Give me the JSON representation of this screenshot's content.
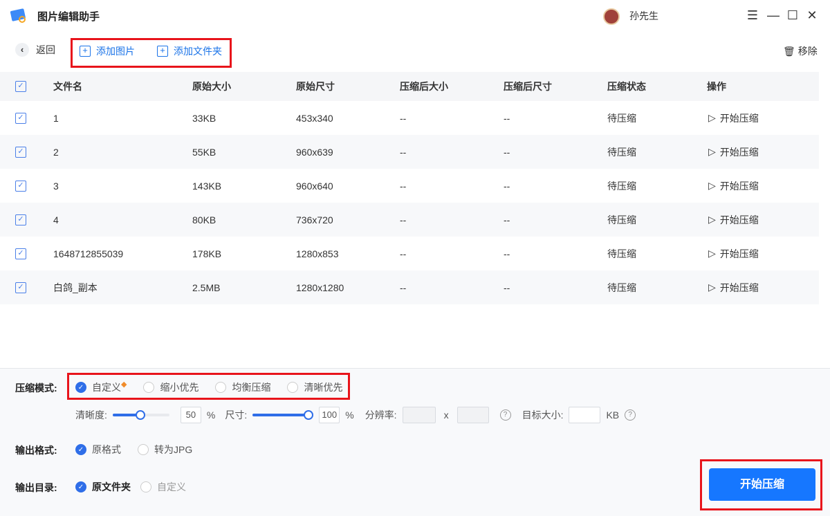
{
  "app": {
    "title": "图片编辑助手",
    "user": "孙先生"
  },
  "toolbar": {
    "back": "返回",
    "add_image": "添加图片",
    "add_folder": "添加文件夹",
    "remove": "移除"
  },
  "table": {
    "headers": [
      "文件名",
      "原始大小",
      "原始尺寸",
      "压缩后大小",
      "压缩后尺寸",
      "压缩状态",
      "操作"
    ],
    "rows": [
      {
        "name": "1",
        "size": "33KB",
        "dims": "453x340",
        "csize": "--",
        "cdims": "--",
        "status": "待压缩",
        "action": "开始压缩"
      },
      {
        "name": "2",
        "size": "55KB",
        "dims": "960x639",
        "csize": "--",
        "cdims": "--",
        "status": "待压缩",
        "action": "开始压缩"
      },
      {
        "name": "3",
        "size": "143KB",
        "dims": "960x640",
        "csize": "--",
        "cdims": "--",
        "status": "待压缩",
        "action": "开始压缩"
      },
      {
        "name": "4",
        "size": "80KB",
        "dims": "736x720",
        "csize": "--",
        "cdims": "--",
        "status": "待压缩",
        "action": "开始压缩"
      },
      {
        "name": "1648712855039",
        "size": "178KB",
        "dims": "1280x853",
        "csize": "--",
        "cdims": "--",
        "status": "待压缩",
        "action": "开始压缩"
      },
      {
        "name": "白鸽_副本",
        "size": "2.5MB",
        "dims": "1280x1280",
        "csize": "--",
        "cdims": "--",
        "status": "待压缩",
        "action": "开始压缩"
      }
    ]
  },
  "settings": {
    "mode_label": "压缩模式:",
    "modes": [
      "自定义",
      "缩小优先",
      "均衡压缩",
      "清晰优先"
    ],
    "clarity_label": "清晰度:",
    "clarity_value": "50",
    "size_label": "尺寸:",
    "size_value": "100",
    "percent": "%",
    "resolution_label": "分辨率:",
    "x": "x",
    "target_label": "目标大小:",
    "kb": "KB",
    "format_label": "输出格式:",
    "formats": [
      "原格式",
      "转为JPG"
    ],
    "dir_label": "输出目录:",
    "dirs": [
      "原文件夹",
      "自定义"
    ]
  },
  "start_button": "开始压缩",
  "colors": {
    "accent": "#1677ff",
    "highlight": "#e8141b"
  }
}
